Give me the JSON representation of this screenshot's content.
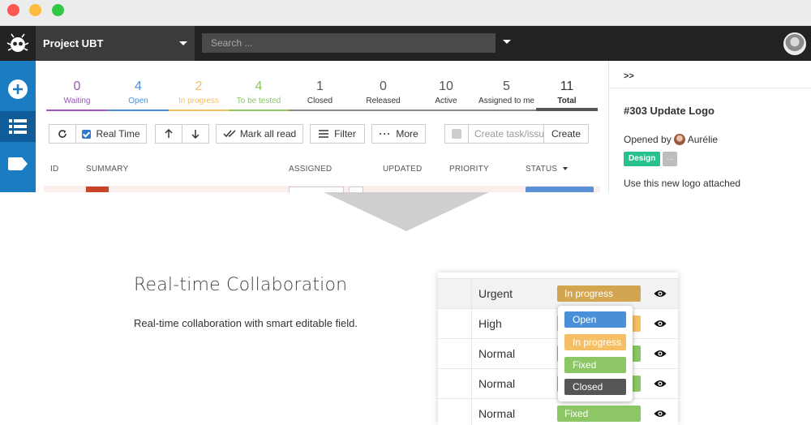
{
  "header": {
    "project_name": "Project UBT",
    "search_placeholder": "Search ..."
  },
  "sidebar": {
    "items": [
      {
        "icon": "plus-icon"
      },
      {
        "icon": "list-icon",
        "active": true
      },
      {
        "icon": "tag-icon"
      }
    ]
  },
  "stats": [
    {
      "count": "0",
      "label": "Waiting",
      "color": "#9b59b6"
    },
    {
      "count": "4",
      "label": "Open",
      "color": "#4a90d9"
    },
    {
      "count": "2",
      "label": "In progress",
      "color": "#f5c065"
    },
    {
      "count": "4",
      "label": "To be tested",
      "color": "#8cc665"
    },
    {
      "count": "1",
      "label": "Closed",
      "color": "#555555"
    },
    {
      "count": "0",
      "label": "Released",
      "color": "#555555"
    },
    {
      "count": "10",
      "label": "Active",
      "color": "#555555"
    },
    {
      "count": "5",
      "label": "Assigned to me",
      "color": "#555555"
    },
    {
      "count": "11",
      "label": "Total",
      "color": "#555555"
    }
  ],
  "toolbar": {
    "realtime_label": "Real Time",
    "mark_all_read_label": "Mark all read",
    "filter_label": "Filter",
    "more_label": "More",
    "create_placeholder": "Create task/issue",
    "create_label": "Create"
  },
  "table": {
    "columns": [
      "ID",
      "SUMMARY",
      "ASSIGNED",
      "UPDATED",
      "PRIORITY",
      "STATUS"
    ]
  },
  "detail": {
    "collapse_label": ">>",
    "title": "#303  Update Logo",
    "opened_by_label": "Opened by",
    "opened_by_user": "Aurélie",
    "tag": "Design",
    "more_tags": "...",
    "description": "Use this new logo attached"
  },
  "feature": {
    "heading": "Real-time Collaboration",
    "text": "Real-time collaboration with smart editable field."
  },
  "demo": {
    "rows": [
      {
        "priority": "Urgent",
        "status": "In progress",
        "status_color": "#d2a550"
      },
      {
        "priority": "High",
        "status": "",
        "status_color": "#f5c065"
      },
      {
        "priority": "Normal",
        "status": "",
        "status_color": "#8cc665"
      },
      {
        "priority": "Normal",
        "status": "",
        "status_color": "#8cc665"
      },
      {
        "priority": "Normal",
        "status": "Fixed",
        "status_color": "#8cc665"
      }
    ],
    "dropdown": [
      {
        "label": "Open",
        "color": "#4a90d9"
      },
      {
        "label": "In progress",
        "color": "#f5c065"
      },
      {
        "label": "Fixed",
        "color": "#8cc665"
      },
      {
        "label": "Closed",
        "color": "#555555"
      }
    ]
  }
}
